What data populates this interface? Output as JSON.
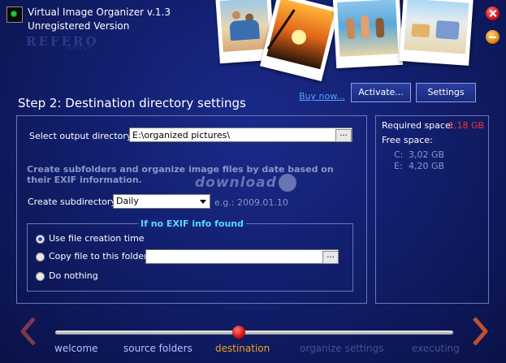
{
  "app": {
    "title": "Virtual Image Organizer v.1.3",
    "subtitle": "Unregistered Version",
    "brand": "REFERO",
    "brand_sub": "GROUP"
  },
  "header": {
    "buy_now": "Buy now...",
    "activate": "Activate...",
    "settings": "Settings"
  },
  "step_title": "Step 2: Destination directory settings",
  "main": {
    "output_label": "Select output directory:",
    "output_value": "E:\\organized pictures\\",
    "browse_label": "...",
    "info_text": "Create subfolders and organize image files by date based on their EXIF information.",
    "subdir_label": "Create subdirectory:",
    "subdir_value": "Daily",
    "example": "e.g.: 2009.01.10",
    "watermark": "download"
  },
  "no_exif": {
    "title": "If no EXIF info found",
    "options": [
      {
        "label": "Use file creation time",
        "selected": true
      },
      {
        "label": "Copy file to this folder:",
        "selected": false
      },
      {
        "label": "Do nothing",
        "selected": false
      }
    ],
    "folder_value": "",
    "browse_label": "..."
  },
  "side": {
    "required_label": "Required space:",
    "required_value": "1,18 GB",
    "free_label": "Free space:",
    "drives": [
      {
        "name": "C:",
        "value": "3,02 GB"
      },
      {
        "name": "E:",
        "value": "4,20 GB"
      }
    ]
  },
  "wizard": {
    "steps": [
      {
        "label": "welcome",
        "state": "done"
      },
      {
        "label": "source folders",
        "state": "done"
      },
      {
        "label": "destination",
        "state": "current"
      },
      {
        "label": "organize settings",
        "state": "todo"
      },
      {
        "label": "executing",
        "state": "todo"
      }
    ],
    "colors": {
      "done": "#b8c2ff",
      "current": "#f0a020",
      "todo": "#46508e"
    }
  }
}
